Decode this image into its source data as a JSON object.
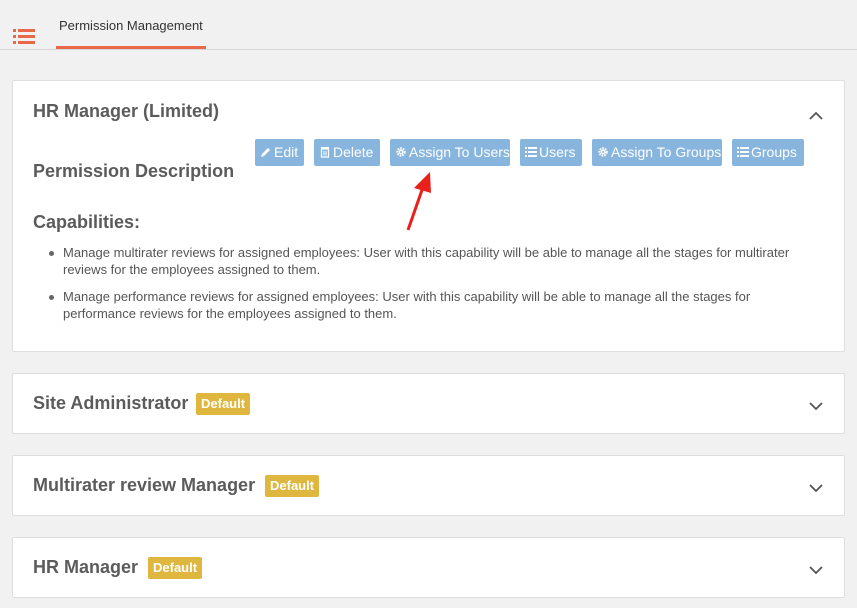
{
  "header": {
    "menu_icon": "list-icon",
    "active_tab": "Permission Management",
    "accent_color": "#e8694a"
  },
  "expanded_panel": {
    "title": "HR Manager (Limited)",
    "description_label": "Permission Description",
    "actions": [
      {
        "label": "Edit",
        "icon": "pencil-icon"
      },
      {
        "label": "Delete",
        "icon": "trash-icon"
      },
      {
        "label": "Assign To Users",
        "icon": "gear-icon"
      },
      {
        "label": "Users",
        "icon": "list-icon"
      },
      {
        "label": "Assign To Groups",
        "icon": "gear-icon"
      },
      {
        "label": "Groups",
        "icon": "list-icon"
      }
    ],
    "capabilities_label": "Capabilities:",
    "capabilities": [
      "Manage multirater reviews for assigned employees: User with this capability will be able to manage all the stages for multirater reviews for the employees assigned to them.",
      "Manage performance reviews for assigned employees: User with this capability will be able to manage all the stages for performance reviews for the employees assigned to them."
    ],
    "button_color": "#88b5dd"
  },
  "collapsed_panels": [
    {
      "title": "Site Administrator",
      "badge": "Default"
    },
    {
      "title": "Multirater review Manager",
      "badge": "Default"
    },
    {
      "title": "HR Manager",
      "badge": "Default"
    }
  ],
  "badge_color": "#e0b73e",
  "annotation_arrow_color": "#e8211d"
}
